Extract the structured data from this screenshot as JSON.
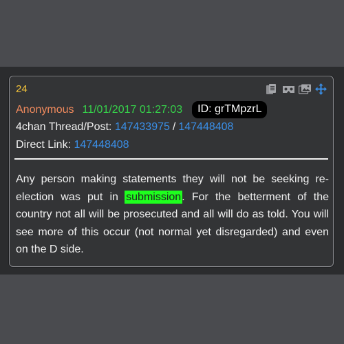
{
  "post": {
    "number": "24",
    "author": "Anonymous",
    "datetime": "11/01/2017 01:27:03",
    "id_label": "ID: grTMpzrL",
    "thread_label": "4chan Thread/Post:",
    "thread_id": "147433975",
    "post_id": "147448408",
    "direct_label": "Direct Link:",
    "direct_id": "147448408",
    "body_before": "Any person making statements they will not be seeking re-election was put in ",
    "body_highlight": "submission",
    "body_after": ". For the betterment of the country not all will be prosecuted and all will do as told. You will see more of this occur (not normal yet disregarded) and even on the D side."
  },
  "toolbar": {
    "icons": [
      "copy-icon",
      "vr-icon",
      "images-icon",
      "move-icon"
    ]
  },
  "colors": {
    "number": "#f2c23a",
    "author": "#f08a5d",
    "date": "#36d14a",
    "link": "#3a8ee6",
    "highlight": "#1eff1e",
    "card_bg": "#333436",
    "page_bg": "#4a4b4f"
  }
}
